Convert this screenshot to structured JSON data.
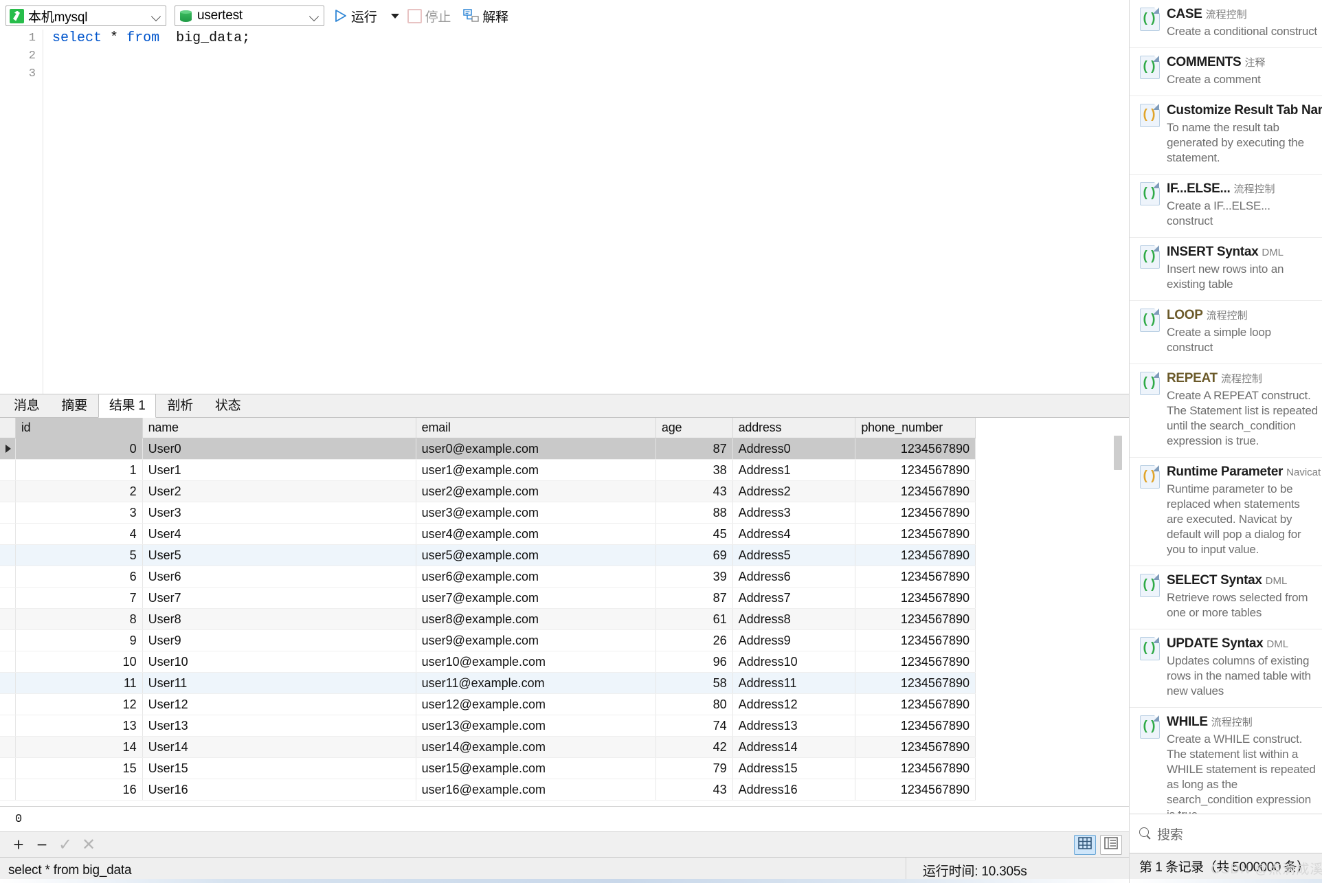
{
  "toolbar": {
    "connection": "本机mysql",
    "database": "usertest",
    "connection_icon": "navicat-connection-icon",
    "database_icon": "database-icon",
    "run_label": "运行",
    "stop_label": "停止",
    "explain_label": "解释"
  },
  "editor": {
    "line_numbers": [
      "1",
      "2",
      "3"
    ],
    "sql": {
      "kw_select": "select",
      "star": "*",
      "kw_from": "from",
      "table": "big_data;"
    }
  },
  "result_tabs": [
    {
      "label": "消息",
      "active": false
    },
    {
      "label": "摘要",
      "active": false
    },
    {
      "label": "结果 1",
      "active": true
    },
    {
      "label": "剖析",
      "active": false
    },
    {
      "label": "状态",
      "active": false
    }
  ],
  "grid": {
    "columns": [
      "id",
      "name",
      "email",
      "age",
      "address",
      "phone_number"
    ],
    "selected_column": "id",
    "rows": [
      {
        "id": "0",
        "name": "User0",
        "email": "user0@example.com",
        "age": "87",
        "address": "Address0",
        "phone_number": "1234567890",
        "style": "selected"
      },
      {
        "id": "1",
        "name": "User1",
        "email": "user1@example.com",
        "age": "38",
        "address": "Address1",
        "phone_number": "1234567890",
        "style": "plain"
      },
      {
        "id": "2",
        "name": "User2",
        "email": "user2@example.com",
        "age": "43",
        "address": "Address2",
        "phone_number": "1234567890",
        "style": "alt"
      },
      {
        "id": "3",
        "name": "User3",
        "email": "user3@example.com",
        "age": "88",
        "address": "Address3",
        "phone_number": "1234567890",
        "style": "plain"
      },
      {
        "id": "4",
        "name": "User4",
        "email": "user4@example.com",
        "age": "45",
        "address": "Address4",
        "phone_number": "1234567890",
        "style": "plain"
      },
      {
        "id": "5",
        "name": "User5",
        "email": "user5@example.com",
        "age": "69",
        "address": "Address5",
        "phone_number": "1234567890",
        "style": "hl"
      },
      {
        "id": "6",
        "name": "User6",
        "email": "user6@example.com",
        "age": "39",
        "address": "Address6",
        "phone_number": "1234567890",
        "style": "plain"
      },
      {
        "id": "7",
        "name": "User7",
        "email": "user7@example.com",
        "age": "87",
        "address": "Address7",
        "phone_number": "1234567890",
        "style": "plain"
      },
      {
        "id": "8",
        "name": "User8",
        "email": "user8@example.com",
        "age": "61",
        "address": "Address8",
        "phone_number": "1234567890",
        "style": "alt"
      },
      {
        "id": "9",
        "name": "User9",
        "email": "user9@example.com",
        "age": "26",
        "address": "Address9",
        "phone_number": "1234567890",
        "style": "plain"
      },
      {
        "id": "10",
        "name": "User10",
        "email": "user10@example.com",
        "age": "96",
        "address": "Address10",
        "phone_number": "1234567890",
        "style": "plain"
      },
      {
        "id": "11",
        "name": "User11",
        "email": "user11@example.com",
        "age": "58",
        "address": "Address11",
        "phone_number": "1234567890",
        "style": "hl"
      },
      {
        "id": "12",
        "name": "User12",
        "email": "user12@example.com",
        "age": "80",
        "address": "Address12",
        "phone_number": "1234567890",
        "style": "plain"
      },
      {
        "id": "13",
        "name": "User13",
        "email": "user13@example.com",
        "age": "74",
        "address": "Address13",
        "phone_number": "1234567890",
        "style": "plain"
      },
      {
        "id": "14",
        "name": "User14",
        "email": "user14@example.com",
        "age": "42",
        "address": "Address14",
        "phone_number": "1234567890",
        "style": "alt"
      },
      {
        "id": "15",
        "name": "User15",
        "email": "user15@example.com",
        "age": "79",
        "address": "Address15",
        "phone_number": "1234567890",
        "style": "plain"
      },
      {
        "id": "16",
        "name": "User16",
        "email": "user16@example.com",
        "age": "43",
        "address": "Address16",
        "phone_number": "1234567890",
        "style": "plain"
      }
    ]
  },
  "value_editor": {
    "value": "0"
  },
  "nav": {
    "add_label": "+",
    "remove_label": "−",
    "confirm_label": "✓",
    "cancel_label": "✕",
    "grid_view_icon": "grid-view-icon",
    "form_view_icon": "form-view-icon"
  },
  "statusbar": {
    "sql": "select * from  big_data",
    "runtime": "运行时间: 10.305s",
    "record_count": "第 1 条记录（共 5000000 条）",
    "watermark": "CSDN @点滴成溪"
  },
  "snippets": {
    "search_placeholder": "搜索",
    "items": [
      {
        "title": "CASE",
        "category": "流程控制",
        "desc": "Create a conditional construct",
        "color": "#2faa47"
      },
      {
        "title": "COMMENTS",
        "category": "注释",
        "desc": "Create a comment",
        "color": "#2faa47"
      },
      {
        "title": "Customize Result Tab Name",
        "category": "",
        "desc": "To name the result tab generated by executing the statement.",
        "color": "#e0a42a"
      },
      {
        "title": "IF...ELSE...",
        "category": "流程控制",
        "desc": "Create a IF...ELSE... construct",
        "color": "#2faa47"
      },
      {
        "title": "INSERT Syntax",
        "category": "DML",
        "desc": "Insert new rows into an existing table",
        "color": "#2faa47"
      },
      {
        "title": "LOOP",
        "category": "流程控制",
        "desc": "Create a simple loop construct",
        "color": "#2faa47"
      },
      {
        "title": "REPEAT",
        "category": "流程控制",
        "desc": "Create A REPEAT construct. The Statement list is repeated until the search_condition expression is true.",
        "color": "#2faa47"
      },
      {
        "title": "Runtime Parameter",
        "category": "Navicat",
        "desc": "Runtime parameter to be replaced when statements are executed. Navicat by default will pop a dialog for you to input value.",
        "color": "#e0a42a"
      },
      {
        "title": "SELECT Syntax",
        "category": "DML",
        "desc": "Retrieve rows selected from one or more tables",
        "color": "#2faa47"
      },
      {
        "title": "UPDATE Syntax",
        "category": "DML",
        "desc": "Updates columns of existing rows in the named table with new values",
        "color": "#2faa47"
      },
      {
        "title": "WHILE",
        "category": "流程控制",
        "desc": "Create a WHILE construct. The statement list within a WHILE statement is repeated as long as the search_condition expression is true.",
        "color": "#2faa47"
      }
    ]
  }
}
